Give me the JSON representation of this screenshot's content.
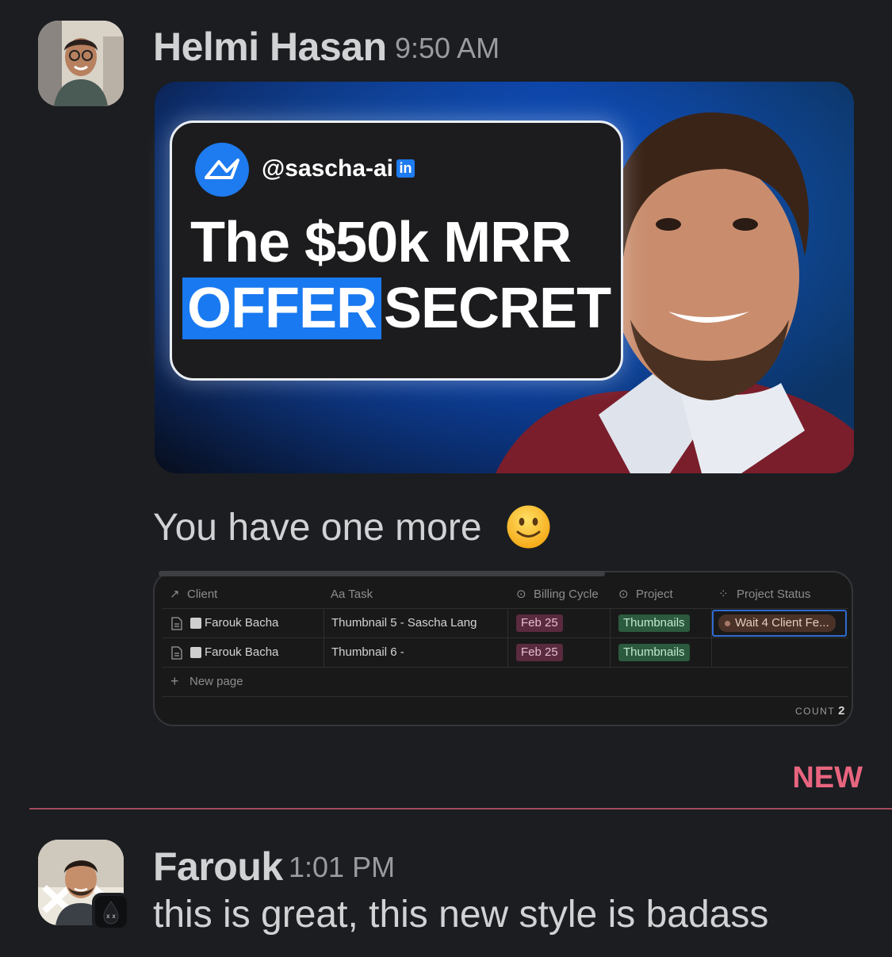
{
  "messages": [
    {
      "sender": "Helmi Hasan",
      "time": "9:50 AM",
      "thumbnail": {
        "handle": "@sascha-ai",
        "linkedin_badge": "in",
        "line1": "The $50k MRR",
        "highlight": "OFFER",
        "line2_rest": "SECRET"
      },
      "text": "You have one more",
      "emoji": "slightly-smiling-face-icon"
    },
    {
      "sender": "Farouk",
      "time": "1:01 PM",
      "text": "this is great, this new style is badass"
    }
  ],
  "table": {
    "columns": [
      "Client",
      "Aa Task",
      "Billing Cycle",
      "Project",
      "Project Status"
    ],
    "rows": [
      {
        "client": "Farouk Bacha",
        "task": "Thumbnail 5 - Sascha Lang",
        "billing": "Feb 25",
        "project": "Thumbnails",
        "status": "Wait 4 Client Fe..."
      },
      {
        "client": "Farouk Bacha",
        "task": "Thumbnail 6 -",
        "billing": "Feb 25",
        "project": "Thumbnails",
        "status": ""
      }
    ],
    "new_page": "New page",
    "count_label": "COUNT",
    "count_value": "2"
  },
  "divider": {
    "label": "NEW"
  },
  "colors": {
    "background": "#1b1d21",
    "new_accent": "#e8657f",
    "billing_tag": "#5a2a3e",
    "project_tag": "#2b5a3e",
    "status_tag": "#4a3228",
    "thumbnail_blue": "#1979f0"
  }
}
